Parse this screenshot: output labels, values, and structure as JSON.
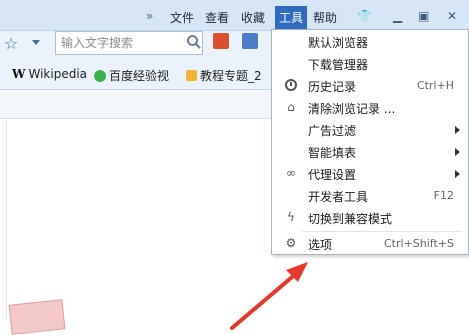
{
  "menubar": {
    "overflow": "»",
    "items": [
      "文件",
      "查看",
      "收藏",
      "工具",
      "帮助"
    ],
    "active": "工具",
    "window_buttons": [
      "shirt-icon",
      "minimize-icon",
      "restore-icon",
      "close-icon"
    ]
  },
  "toolbar": {
    "search": {
      "placeholder": "输入文字搜索"
    }
  },
  "bookmarks": [
    "Wikipedia",
    "百度经验视",
    "教程专题_2"
  ],
  "tools_menu": {
    "items": [
      {
        "label": "默认浏览器",
        "shortcut": "",
        "submenu": false,
        "icon": ""
      },
      {
        "label": "下载管理器",
        "shortcut": "",
        "submenu": false,
        "icon": ""
      },
      {
        "label": "历史记录",
        "shortcut": "Ctrl+H",
        "submenu": false,
        "icon": "clock-icon"
      },
      {
        "label": "清除浏览记录 ...",
        "shortcut": "",
        "submenu": false,
        "icon": "broom-icon"
      },
      {
        "label": "广告过滤",
        "shortcut": "",
        "submenu": true,
        "icon": ""
      },
      {
        "label": "智能填表",
        "shortcut": "",
        "submenu": true,
        "icon": ""
      },
      {
        "label": "代理设置",
        "shortcut": "",
        "submenu": true,
        "icon": "link-icon"
      },
      {
        "label": "开发者工具",
        "shortcut": "F12",
        "submenu": false,
        "icon": ""
      },
      {
        "label": "切换到兼容模式",
        "shortcut": "",
        "submenu": false,
        "icon": "lightning-icon"
      },
      {
        "label": "选项",
        "shortcut": "Ctrl+Shift+S",
        "submenu": false,
        "icon": "gear-icon"
      }
    ]
  },
  "colors": {
    "menubar_bg": "#d6e6f6",
    "active_menu": "#2f6cc0",
    "annotation_arrow": "#e8372b"
  }
}
